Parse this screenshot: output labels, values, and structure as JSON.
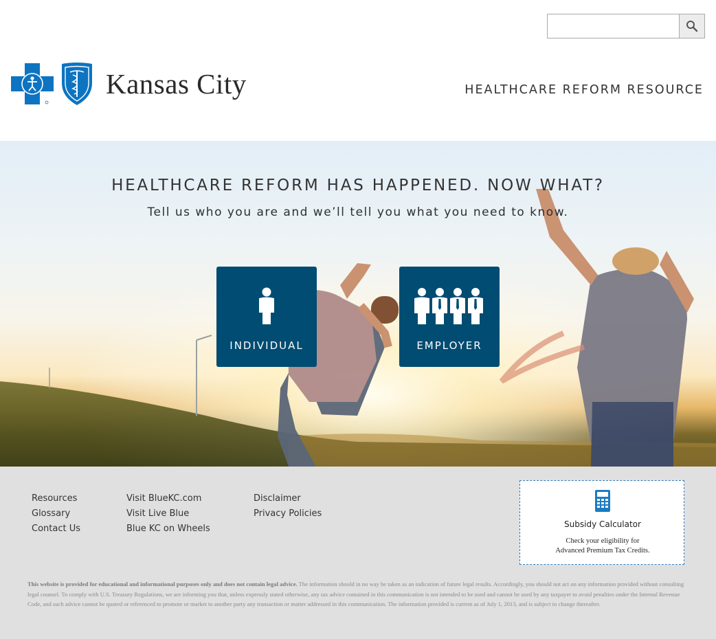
{
  "header": {
    "search": {
      "placeholder": "",
      "value": ""
    },
    "logo_text": "Kansas City",
    "site_tag": "HEALTHCARE REFORM RESOURCE"
  },
  "hero": {
    "title": "HEALTHCARE REFORM HAS HAPPENED. NOW WHAT?",
    "subtitle": "Tell us who you are and we’ll tell you what you need to know.",
    "tiles": [
      {
        "label": "INDIVIDUAL",
        "icon": "person-icon"
      },
      {
        "label": "EMPLOYER",
        "icon": "group-icon"
      }
    ]
  },
  "footer": {
    "col1": [
      "Resources",
      "Glossary",
      "Contact Us"
    ],
    "col2": [
      "Visit BlueKC.com",
      "Visit Live Blue",
      "Blue KC on Wheels"
    ],
    "col3": [
      "Disclaimer",
      "Privacy Policies"
    ],
    "calculator": {
      "title": "Subsidy Calculator",
      "desc_line1": "Check your eligibility for",
      "desc_line2": "Advanced Premium Tax Credits."
    },
    "disclaimer_bold": "This website is provided for educational and informational purposes only and does not contain legal advice.",
    "disclaimer_text": " The information should in no way be taken as an indication of future legal results. Accordingly, you should not act on any information provided without consulting legal counsel. To comply with U.S. Treasury Regulations, we are informing you that, unless expressly stated otherwise, any tax advice contained in this communication is not intended to be used and cannot be used by any taxpayer to avoid penalties under the Internal Revenue Code, and such advice cannot be quoted or referenced to promote or market to another party any transaction or matter addressed in this communication. The information provided is current as of July 1, 2013, and is subject to change thereafter."
  },
  "colors": {
    "brand_blue": "#0d74c1",
    "tile_blue": "#004c72",
    "footer_bg": "#e0e0e0"
  }
}
